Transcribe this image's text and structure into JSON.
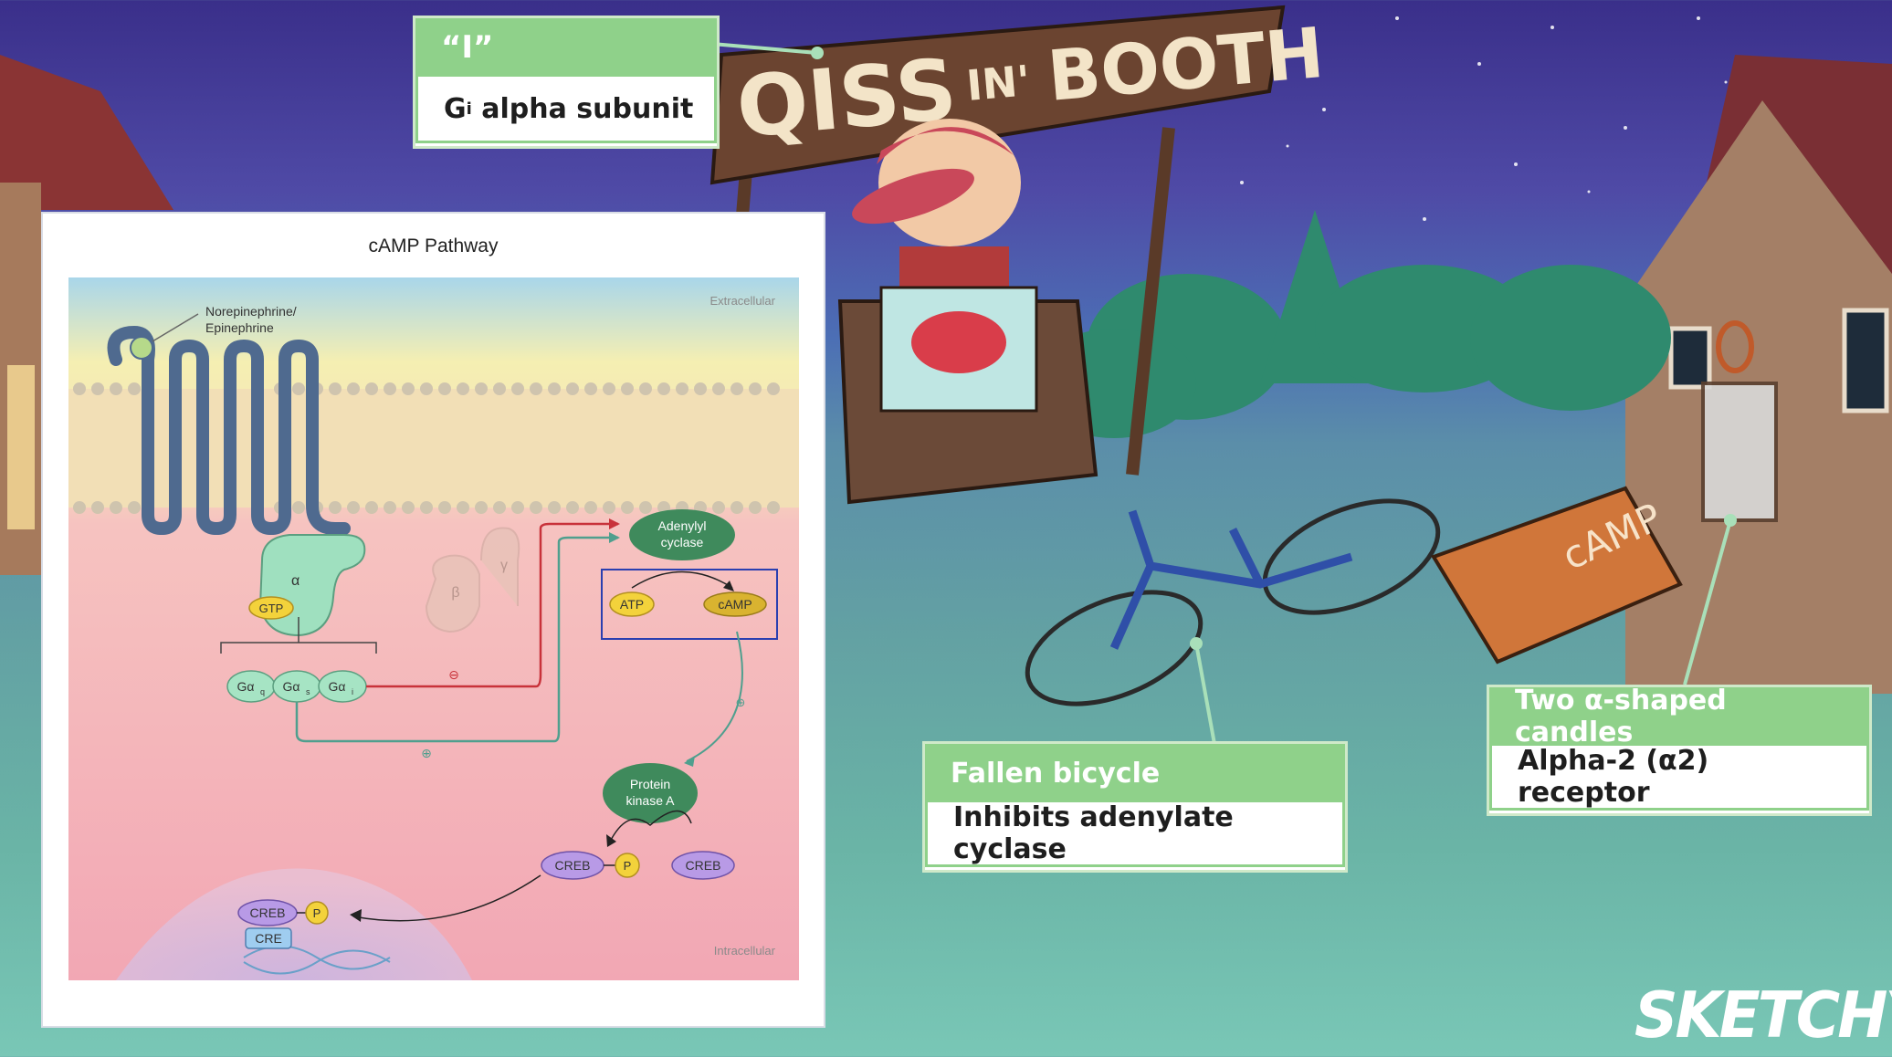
{
  "sign": {
    "text_main": "QISS",
    "text_small": "IN'",
    "text_end": "BOOTH"
  },
  "callouts": {
    "i_symbol": {
      "head": "“I”",
      "body_prefix": "G",
      "body_sub": "i",
      "body_rest": " alpha subunit"
    },
    "bicycle": {
      "head": "Fallen bicycle",
      "body": "Inhibits adenylate cyclase"
    },
    "candles": {
      "head": "Two α-shaped candles",
      "body": "Alpha-2 (α2) receptor"
    }
  },
  "diagram": {
    "title": "cAMP Pathway",
    "extracellular": "Extracellular",
    "intracellular": "Intracellular",
    "ligand_line1": "Norepinephrine/",
    "ligand_line2": "Epinephrine",
    "alpha": "α",
    "beta": "β",
    "gamma": "γ",
    "gtp": "GTP",
    "ga_q": "Gα",
    "ga_q_sub": "q",
    "ga_s": "Gα",
    "ga_s_sub": "s",
    "ga_i": "Gα",
    "ga_i_sub": "i",
    "inhibit_sign": "⊖",
    "activate_sign": "⊕",
    "adenylyl_line1": "Adenylyl",
    "adenylyl_line2": "cyclase",
    "atp": "ATP",
    "camp": "cAMP",
    "pka_line1": "Protein",
    "pka_line2": "kinase A",
    "creb": "CREB",
    "p": "P",
    "cre": "CRE"
  },
  "bag_label": "cAMP",
  "logo": "SKETCHY",
  "colors": {
    "callout_green": "#8fd18a",
    "inhibit_red": "#c8323a",
    "activate_teal": "#4f9f8e",
    "ac_green": "#3f8a5c"
  }
}
